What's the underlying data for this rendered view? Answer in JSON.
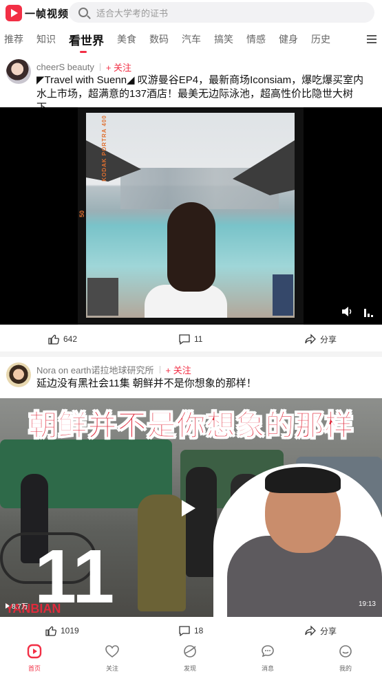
{
  "app": {
    "name": "一帧视频"
  },
  "search": {
    "placeholder": "适合大学考的证书"
  },
  "tabs": [
    {
      "label": "推荐"
    },
    {
      "label": "知识"
    },
    {
      "label": "看世界",
      "active": true
    },
    {
      "label": "美食"
    },
    {
      "label": "数码"
    },
    {
      "label": "汽车"
    },
    {
      "label": "搞笑"
    },
    {
      "label": "情感"
    },
    {
      "label": "健身"
    },
    {
      "label": "历史"
    }
  ],
  "posts": [
    {
      "author": "cheerS beauty",
      "follow_label": "+ 关注",
      "title": "◤Travel with Suenn◢ 叹游曼谷EP4，最新商场Iconsiam，爆吃爆买室内水上市场，超满意的137酒店！最美无边际泳池，超高性价比隐世大树下…",
      "film_label": "KODAK PORTRA 400",
      "film_number": "50",
      "likes": "642",
      "comments": "11",
      "share_label": "分享"
    },
    {
      "author": "Nora on earth诺拉地球研究所",
      "follow_label": "+ 关注",
      "title": "延边没有黑社会11集 朝鲜并不是你想象的那样！",
      "overlay_title": "朝鲜并不是你想象的那样",
      "episode": "11",
      "watermark": "YANBIAN",
      "views": "8.7万",
      "duration": "19:13",
      "likes": "1019",
      "comments": "18",
      "share_label": "分享"
    }
  ],
  "bottom_nav": [
    {
      "label": "首页",
      "icon": "home-icon",
      "active": true
    },
    {
      "label": "关注",
      "icon": "heart-icon"
    },
    {
      "label": "发现",
      "icon": "planet-icon"
    },
    {
      "label": "消息",
      "icon": "message-icon"
    },
    {
      "label": "我的",
      "icon": "profile-icon"
    }
  ],
  "colors": {
    "accent": "#f22f45",
    "text": "#111111",
    "muted": "#777777"
  }
}
